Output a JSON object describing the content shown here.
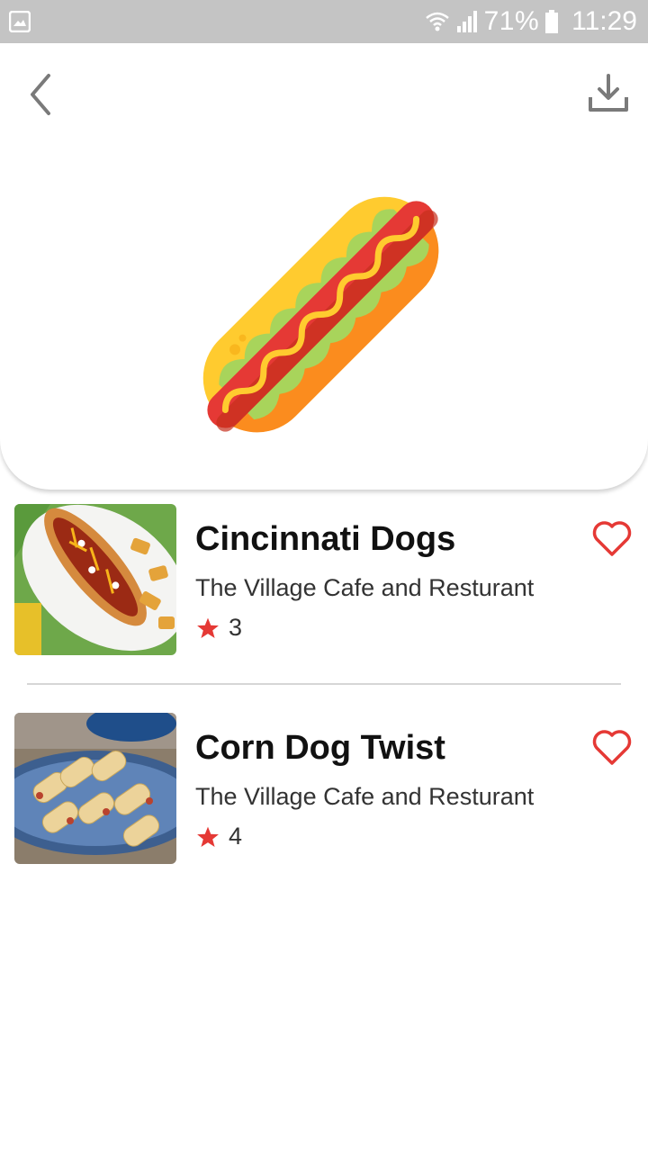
{
  "status_bar": {
    "battery": "71%",
    "time": "11:29"
  },
  "header": {
    "back_icon": "chevron-left-icon",
    "download_icon": "download-icon",
    "hero_icon": "hot-dog-illustration"
  },
  "items": [
    {
      "title": "Cincinnati Dogs",
      "restaurant": "The Village Cafe and Resturant",
      "rating": "3"
    },
    {
      "title": "Corn Dog Twist",
      "restaurant": "The Village Cafe and Resturant",
      "rating": "4"
    }
  ],
  "colors": {
    "accent": "#e53935",
    "status_bar": "#c4c4c4"
  }
}
